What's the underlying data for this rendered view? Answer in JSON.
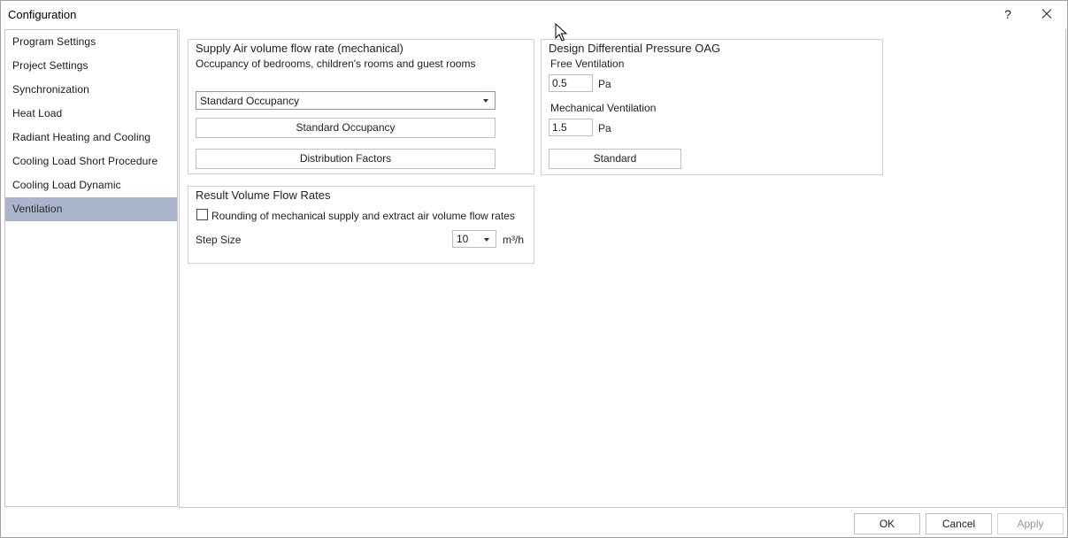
{
  "window": {
    "title": "Configuration",
    "help_label": "?",
    "close_icon": "close-icon"
  },
  "sidebar": {
    "items": [
      {
        "label": "Program Settings"
      },
      {
        "label": "Project Settings"
      },
      {
        "label": "Synchronization"
      },
      {
        "label": "Heat Load"
      },
      {
        "label": "Radiant Heating and Cooling"
      },
      {
        "label": "Cooling Load Short Procedure"
      },
      {
        "label": "Cooling Load Dynamic"
      },
      {
        "label": "Ventilation",
        "selected": true
      }
    ]
  },
  "supply": {
    "title": "Supply Air volume flow rate (mechanical)",
    "subtitle": "Occupancy of bedrooms, children's rooms and guest rooms",
    "occupancy_value": "Standard Occupancy",
    "button_standard": "Standard Occupancy",
    "button_distribution": "Distribution Factors"
  },
  "pressure": {
    "title": "Design Differential Pressure OAG",
    "free_label": "Free Ventilation",
    "free_value": "0.5",
    "free_unit": "Pa",
    "mech_label": "Mechanical Ventilation",
    "mech_value": "1.5",
    "mech_unit": "Pa",
    "button_standard": "Standard"
  },
  "result": {
    "title": "Result Volume Flow Rates",
    "rounding_label": "Rounding of mechanical supply and extract air volume flow rates",
    "rounding_checked": false,
    "step_label": "Step Size",
    "step_value": "10",
    "step_unit": "m³/h"
  },
  "footer": {
    "ok": "OK",
    "cancel": "Cancel",
    "apply": "Apply"
  },
  "colors": {
    "selected_nav_bg": "#aab4cc",
    "focus_border": "#7a96c8"
  }
}
